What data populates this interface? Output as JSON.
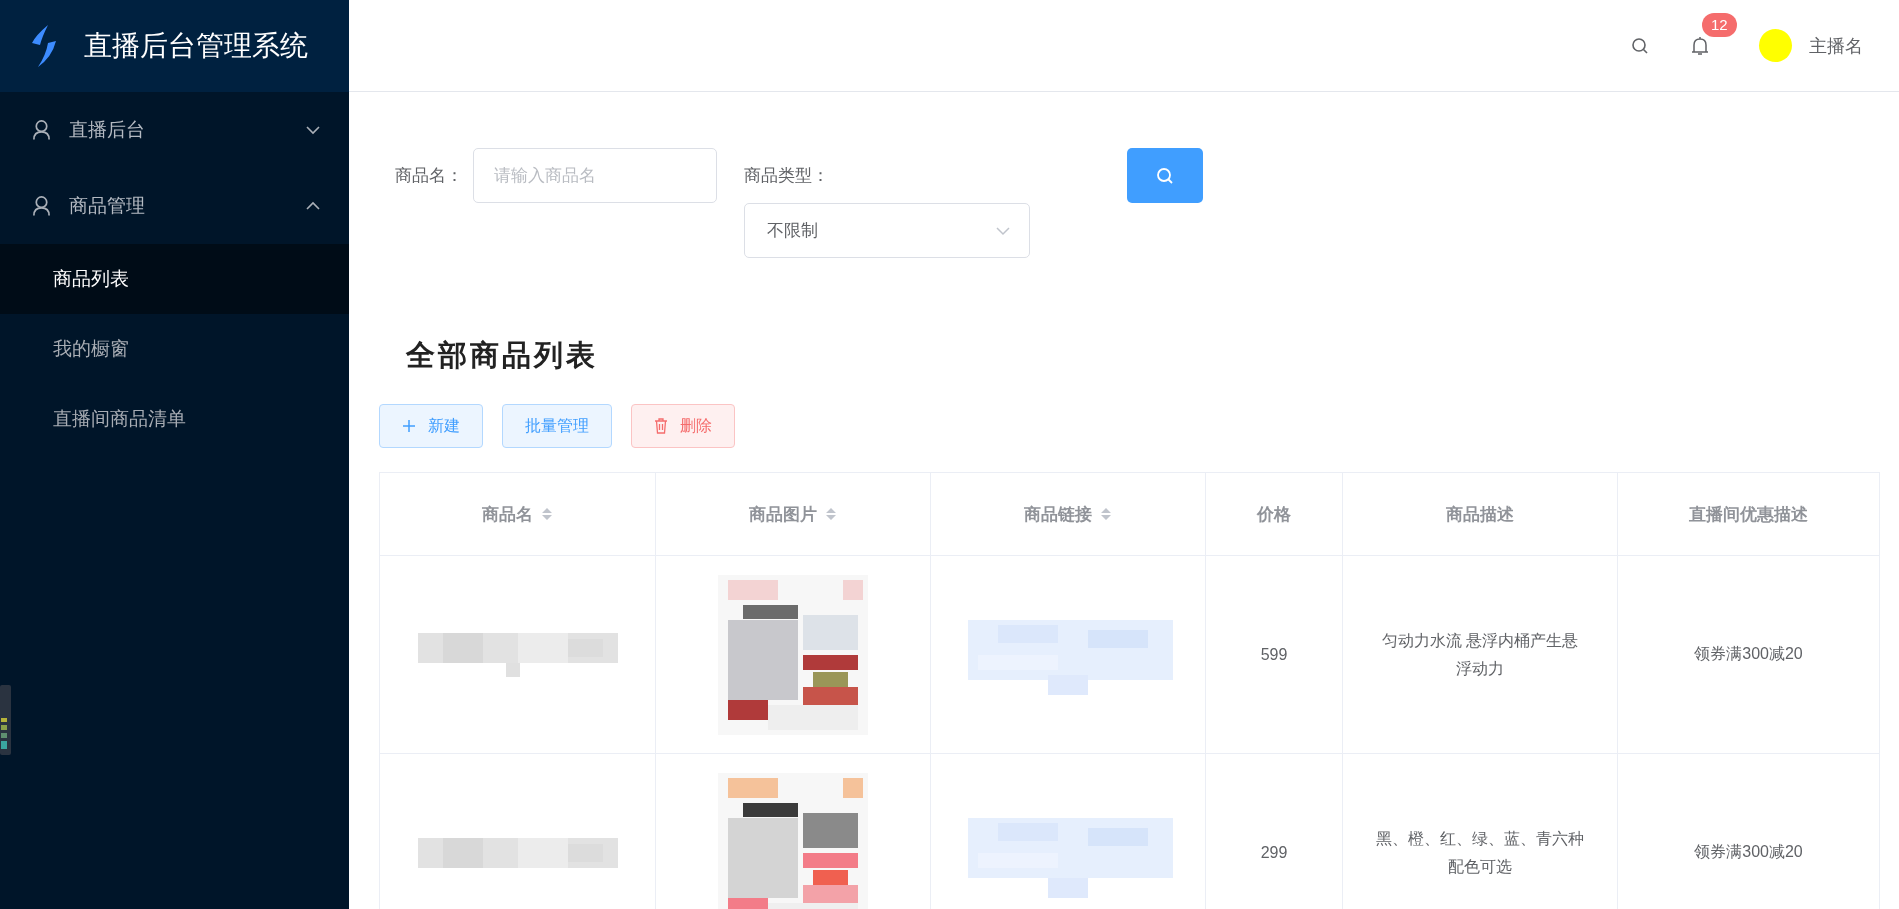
{
  "app": {
    "title": "直播后台管理系统"
  },
  "sidebar": {
    "menus": [
      {
        "label": "直播后台",
        "expanded": false
      },
      {
        "label": "商品管理",
        "expanded": true,
        "children": [
          {
            "label": "商品列表",
            "selected": true
          },
          {
            "label": "我的橱窗",
            "selected": false
          },
          {
            "label": "直播间商品清单",
            "selected": false
          }
        ]
      }
    ]
  },
  "header": {
    "notification_count": "12",
    "user_name": "主播名"
  },
  "filters": {
    "name_label": "商品名：",
    "name_placeholder": "请输入商品名",
    "type_label": "商品类型：",
    "type_value": "不限制"
  },
  "section_title": "全部商品列表",
  "actions": [
    {
      "label": "新建",
      "kind": "add"
    },
    {
      "label": "批量管理",
      "kind": "plain"
    },
    {
      "label": "删除",
      "kind": "delete"
    }
  ],
  "table": {
    "columns": [
      {
        "label": "商品名",
        "sortable": true
      },
      {
        "label": "商品图片",
        "sortable": true
      },
      {
        "label": "商品链接",
        "sortable": true
      },
      {
        "label": "价格",
        "sortable": false
      },
      {
        "label": "商品描述",
        "sortable": false
      },
      {
        "label": "直播间优惠描述",
        "sortable": false
      }
    ],
    "rows": [
      {
        "price": "599",
        "description": "匀动力水流 悬浮内桶产生悬浮动力",
        "promotion": "领券满300减20"
      },
      {
        "price": "299",
        "description": "黑、橙、红、绿、蓝、青六种配色可选",
        "promotion": "领券满300减20"
      }
    ]
  }
}
